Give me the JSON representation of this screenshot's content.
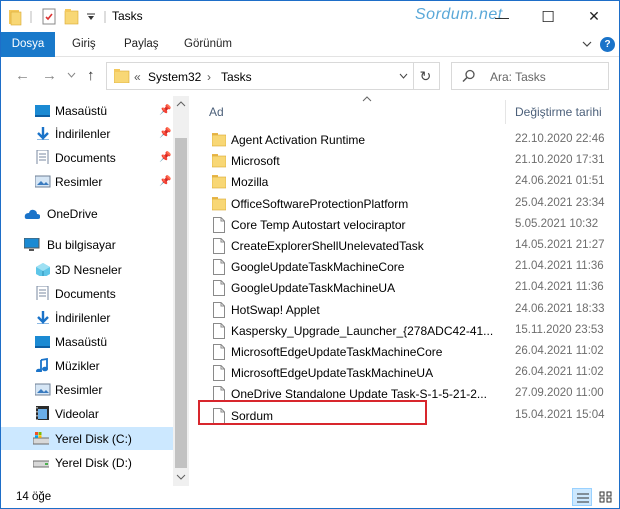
{
  "window": {
    "title": "Tasks",
    "watermark": "Sordum.net",
    "minimize_label": "—",
    "maximize_label": "☐",
    "close_label": "✕"
  },
  "ribbon": {
    "tabs": [
      "Dosya",
      "Giriş",
      "Paylaş",
      "Görünüm"
    ]
  },
  "address": {
    "path": [
      "System32",
      "Tasks"
    ],
    "overflow_label": "«",
    "separator": "›",
    "search_placeholder": "Ara: Tasks"
  },
  "nav": {
    "quick_access": [
      {
        "label": "Masaüstü",
        "icon": "desktop-icon",
        "pinned": true
      },
      {
        "label": "İndirilenler",
        "icon": "download-icon",
        "pinned": true
      },
      {
        "label": "Documents",
        "icon": "documents-icon",
        "pinned": true
      },
      {
        "label": "Resimler",
        "icon": "pictures-icon",
        "pinned": true
      }
    ],
    "onedrive": "OneDrive",
    "this_pc": "Bu bilgisayar",
    "pc_items": [
      {
        "label": "3D Nesneler",
        "icon": "3d-objects-icon"
      },
      {
        "label": "Documents",
        "icon": "documents-icon"
      },
      {
        "label": "İndirilenler",
        "icon": "download-icon"
      },
      {
        "label": "Masaüstü",
        "icon": "desktop-icon"
      },
      {
        "label": "Müzikler",
        "icon": "music-icon"
      },
      {
        "label": "Resimler",
        "icon": "pictures-icon"
      },
      {
        "label": "Videolar",
        "icon": "videos-icon"
      },
      {
        "label": "Yerel Disk (C:)",
        "icon": "disk-c-icon",
        "selected": true
      },
      {
        "label": "Yerel Disk (D:)",
        "icon": "disk-d-icon"
      }
    ]
  },
  "list": {
    "col_name": "Ad",
    "col_date": "Değiştirme tarihi",
    "items": [
      {
        "name": "Agent Activation Runtime",
        "date": "22.10.2020 22:46",
        "type": "folder"
      },
      {
        "name": "Microsoft",
        "date": "21.10.2020 17:31",
        "type": "folder"
      },
      {
        "name": "Mozilla",
        "date": "24.06.2021 01:51",
        "type": "folder"
      },
      {
        "name": "OfficeSoftwareProtectionPlatform",
        "date": "25.04.2021 23:34",
        "type": "folder"
      },
      {
        "name": "Core Temp Autostart velociraptor",
        "date": "5.05.2021 10:32",
        "type": "file"
      },
      {
        "name": "CreateExplorerShellUnelevatedTask",
        "date": "14.05.2021 21:27",
        "type": "file"
      },
      {
        "name": "GoogleUpdateTaskMachineCore",
        "date": "21.04.2021 11:36",
        "type": "file"
      },
      {
        "name": "GoogleUpdateTaskMachineUA",
        "date": "21.04.2021 11:36",
        "type": "file"
      },
      {
        "name": "HotSwap! Applet",
        "date": "24.06.2021 18:33",
        "type": "file"
      },
      {
        "name": "Kaspersky_Upgrade_Launcher_{278ADC42-41...",
        "date": "15.11.2020 23:53",
        "type": "file"
      },
      {
        "name": "MicrosoftEdgeUpdateTaskMachineCore",
        "date": "26.04.2021 11:02",
        "type": "file"
      },
      {
        "name": "MicrosoftEdgeUpdateTaskMachineUA",
        "date": "26.04.2021 11:02",
        "type": "file"
      },
      {
        "name": "OneDrive Standalone Update Task-S-1-5-21-2...",
        "date": "27.09.2020 11:00",
        "type": "file"
      },
      {
        "name": "Sordum",
        "date": "15.04.2021 15:04",
        "type": "file",
        "highlighted": true
      }
    ]
  },
  "status": {
    "count": "14 öğe"
  },
  "colors": {
    "accent": "#1979ca",
    "folder": "#f8d775",
    "highlight_border": "#d8262d",
    "selected_bg": "#cce8ff"
  }
}
